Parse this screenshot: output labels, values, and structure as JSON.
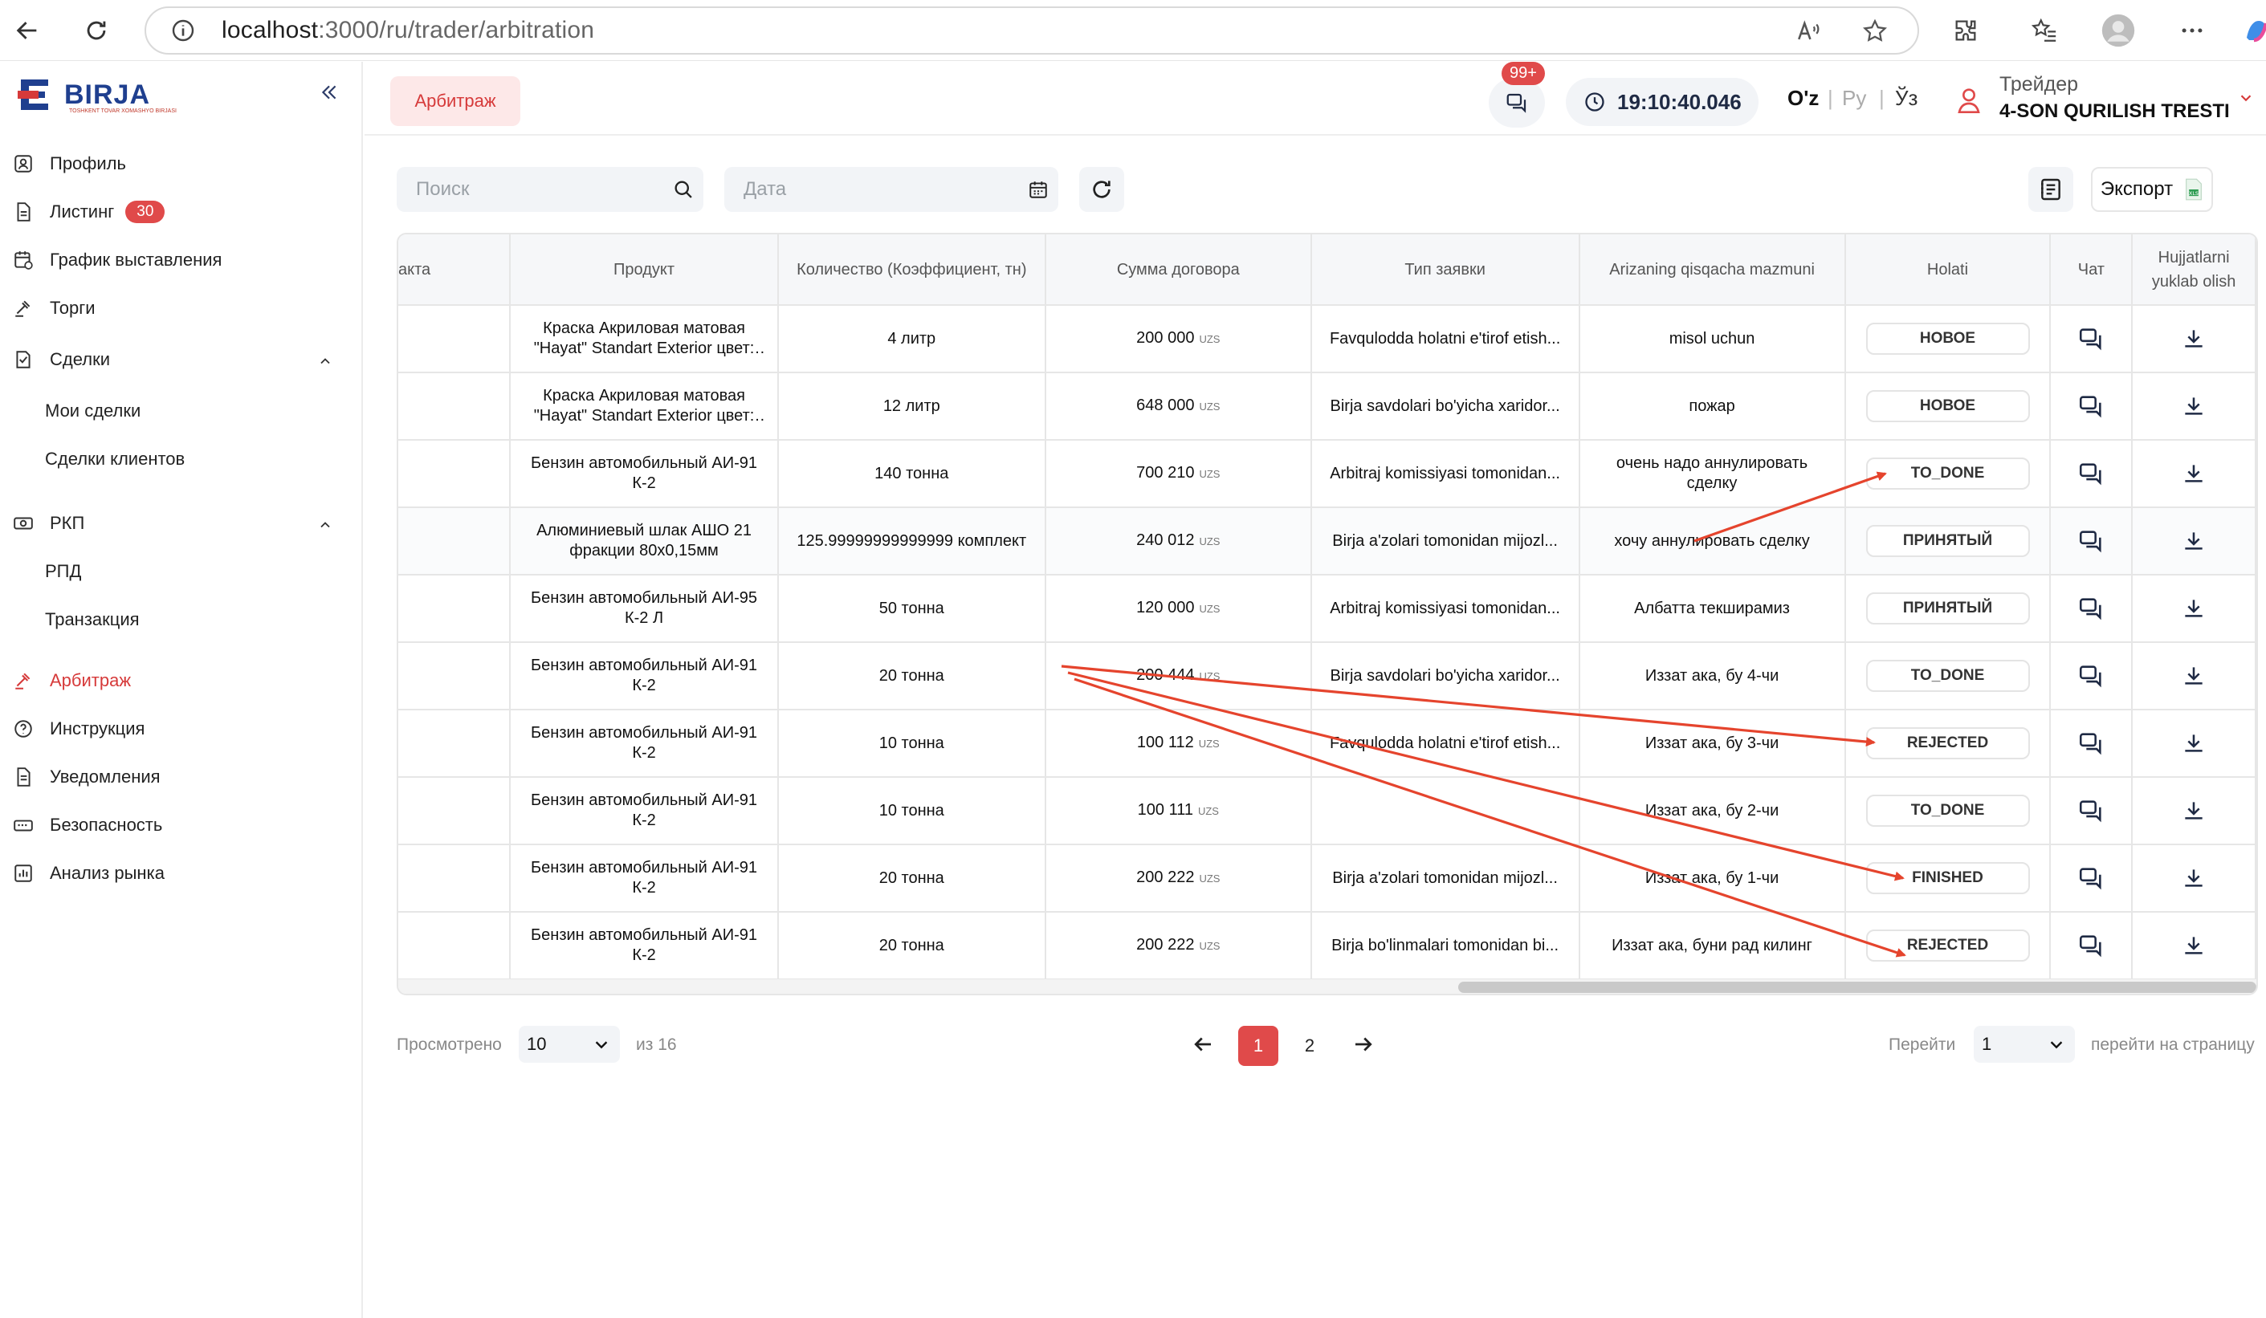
{
  "browser": {
    "url_host": "localhost",
    "url_path": ":3000/ru/trader/arbitration"
  },
  "sidebar": {
    "logo_text": "BIRJA",
    "logo_subtext": "TOSHKENT TOVAR XOMASHYO BIRJASI",
    "items": [
      {
        "label": "Профиль",
        "icon": "profile-icon"
      },
      {
        "label": "Листинг",
        "icon": "document-icon",
        "badge": "30"
      },
      {
        "label": "График выставления",
        "icon": "schedule-icon"
      },
      {
        "label": "Торги",
        "icon": "gavel-icon"
      },
      {
        "label": "Сделки",
        "icon": "deals-icon"
      },
      {
        "label": "РКП",
        "icon": "rkp-icon"
      },
      {
        "label": "Арбитраж",
        "icon": "arbitration-icon"
      },
      {
        "label": "Инструкция",
        "icon": "help-icon"
      },
      {
        "label": "Уведомления",
        "icon": "notification-icon"
      },
      {
        "label": "Безопасность",
        "icon": "security-icon"
      },
      {
        "label": "Анализ рынка",
        "icon": "chart-icon"
      }
    ],
    "deals_sub": [
      "Мои сделки",
      "Сделки клиентов"
    ],
    "rkp_sub": [
      "РПД",
      "Транзакция"
    ]
  },
  "header": {
    "page_chip": "Арбитраж",
    "chat_badge": "99+",
    "clock": "19:10:40.046",
    "langs": [
      "O'z",
      "Ру",
      "Ўз"
    ],
    "user_role": "Трейдер",
    "user_name": "4-SON QURILISH TRESTI"
  },
  "filters": {
    "search_placeholder": "Поиск",
    "date_placeholder": "Дата",
    "export_label": "Экспорт"
  },
  "table": {
    "headers": [
      "акта",
      "Продукт",
      "Количество (Коэффициент, тн)",
      "Сумма договора",
      "Тип заявки",
      "Arizaning qisqacha mazmuni",
      "Holati",
      "Чат",
      "Hujjatlarni yuklab olish"
    ],
    "currency": "UZS",
    "rows": [
      {
        "product": "Краска Акриловая матовая \"Hayat\" Standart Exterior цвет: а...",
        "qty": "4 литр",
        "sum": "200 000",
        "type": "Favqulodda holatni e'tirof etish...",
        "summary": "misol uchun",
        "status": "НОВОЕ"
      },
      {
        "product": "Краска Акриловая матовая \"Hayat\" Standart Exterior цвет: а...",
        "qty": "12 литр",
        "sum": "648 000",
        "type": "Birja savdolari bo'yicha xaridor...",
        "summary": "пожар",
        "status": "НОВОЕ"
      },
      {
        "product": "Бензин автомобильный АИ-91 К-2",
        "qty": "140 тонна",
        "sum": "700 210",
        "type": "Arbitraj komissiyasi tomonidan...",
        "summary": "очень надо аннулировать сделку",
        "status": "TO_DONE"
      },
      {
        "product": "Алюминиевый шлак АШО 21 фракции 80х0,15мм",
        "qty": "125.99999999999999 комплект",
        "sum": "240 012",
        "type": "Birja a'zolari tomonidan mijozl...",
        "summary": "хочу аннулировать сделку",
        "status": "ПРИНЯТЫЙ"
      },
      {
        "product": "Бензин автомобильный АИ-95 К-2 Л",
        "qty": "50 тонна",
        "sum": "120 000",
        "type": "Arbitraj komissiyasi tomonidan...",
        "summary": "Албатта текширамиз",
        "status": "ПРИНЯТЫЙ"
      },
      {
        "product": "Бензин автомобильный АИ-91 К-2",
        "qty": "20 тонна",
        "sum": "200 444",
        "type": "Birja savdolari bo'yicha xaridor...",
        "summary": "Иззат ака, бу 4-чи",
        "status": "TO_DONE"
      },
      {
        "product": "Бензин автомобильный АИ-91 К-2",
        "qty": "10 тонна",
        "sum": "100 112",
        "type": "Favqulodda holatni e'tirof etish...",
        "summary": "Иззат ака, бу 3-чи",
        "status": "REJECTED"
      },
      {
        "product": "Бензин автомобильный АИ-91 К-2",
        "qty": "10 тонна",
        "sum": "100 111",
        "type": "",
        "summary": "Иззат ака, бу 2-чи",
        "status": "TO_DONE"
      },
      {
        "product": "Бензин автомобильный АИ-91 К-2",
        "qty": "20 тонна",
        "sum": "200 222",
        "type": "Birja a'zolari tomonidan mijozl...",
        "summary": "Иззат ака, бу 1-чи",
        "status": "FINISHED"
      },
      {
        "product": "Бензин автомобильный АИ-91 К-2",
        "qty": "20 тонна",
        "sum": "200 222",
        "type": "Birja bo'linmalari tomonidan bi...",
        "summary": "Иззат ака, буни рад килинг",
        "status": "REJECTED"
      }
    ]
  },
  "pagination": {
    "viewed_label": "Просмотрено",
    "page_size": "10",
    "of_label": "из 16",
    "pages": [
      "1",
      "2"
    ],
    "goto_label": "Перейти",
    "goto_value": "1",
    "goto_suffix": "перейти на страницу"
  },
  "colors": {
    "accent": "#e04a4a",
    "annotation_arrow": "#e5442d"
  }
}
